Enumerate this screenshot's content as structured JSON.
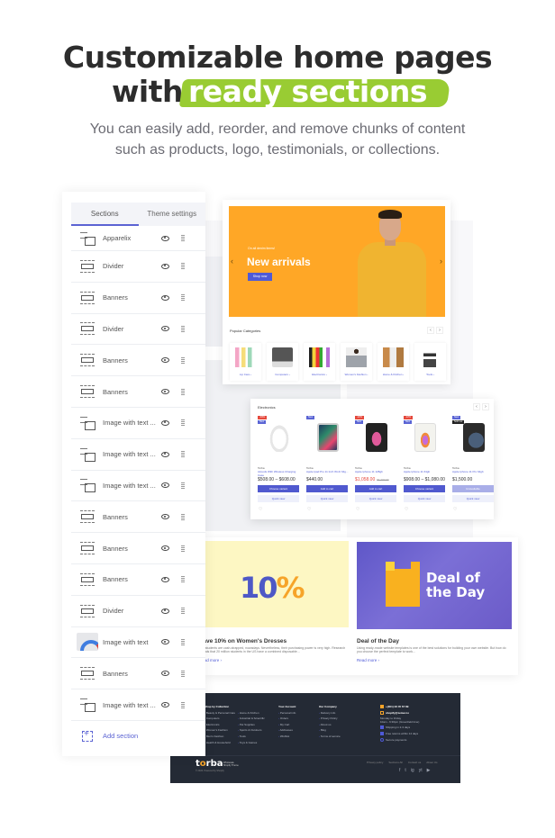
{
  "header": {
    "title_line1": "Customizable home pages",
    "title_line2_prefix": "with",
    "title_line2_highlight": "ready sections",
    "subtitle_line1": "You can easily add, reorder, and remove chunks of content",
    "subtitle_line2": "such as products, logo, testimonials, or collections.",
    "highlight_color": "#99cc33"
  },
  "sidebar": {
    "tabs": [
      {
        "label": "Sections",
        "active": true
      },
      {
        "label": "Theme settings",
        "active": false
      }
    ],
    "items": [
      {
        "label": "Apparelix",
        "icon": "image-with-text-icon"
      },
      {
        "label": "Divider",
        "icon": "banner-icon"
      },
      {
        "label": "Banners",
        "icon": "banner-icon"
      },
      {
        "label": "Divider",
        "icon": "banner-icon"
      },
      {
        "label": "Banners",
        "icon": "banner-icon"
      },
      {
        "label": "Banners",
        "icon": "banner-icon"
      },
      {
        "label": "Image with text ...",
        "icon": "image-with-text-icon"
      },
      {
        "label": "Image with text ...",
        "icon": "image-with-text-icon"
      },
      {
        "label": "Image with text ...",
        "icon": "image-with-text-icon"
      },
      {
        "label": "Banners",
        "icon": "banner-icon"
      },
      {
        "label": "Banners",
        "icon": "banner-icon"
      },
      {
        "label": "Banners",
        "icon": "banner-icon"
      },
      {
        "label": "Divider",
        "icon": "banner-icon"
      },
      {
        "label": "Image with text",
        "icon": "gauge-thumbnail-icon"
      },
      {
        "label": "Banners",
        "icon": "banner-icon"
      },
      {
        "label": "Image with text ...",
        "icon": "image-with-text-icon"
      }
    ],
    "add_section_label": "Add section",
    "accent_color": "#5b63d3"
  },
  "hero_banner": {
    "kicker": "On all denim items!",
    "title": "New arrivals",
    "button_label": "Shop now",
    "prev_arrow": "‹",
    "next_arrow": "›",
    "background_color": "#ffa726"
  },
  "categories": {
    "title": "Popular Categories",
    "items": [
      {
        "label": "Lip Care ›"
      },
      {
        "label": "Computers ›"
      },
      {
        "label": "Electronics ›"
      },
      {
        "label": "Women's Fashion ›"
      },
      {
        "label": "Home & Kitchen ›"
      },
      {
        "label": "Tools ›"
      }
    ]
  },
  "electronics": {
    "title": "Electronics",
    "products": [
      {
        "vendor": "Torba",
        "name": "Airpods With Wireless Charging Case",
        "price": "$508.00 – $608.00",
        "old_price": "",
        "on_sale": false,
        "badges": [
          "-33%",
          "New"
        ],
        "button": "Choose variant",
        "unavailable": false,
        "quick_view": "Quick view"
      },
      {
        "vendor": "Torba",
        "name": "Apple Ipad Pro 11 Inch Wi-Fi 64g...",
        "price": "$440.00",
        "old_price": "",
        "on_sale": false,
        "badges": [
          "New"
        ],
        "button": "Add to cart",
        "unavailable": false,
        "quick_view": "Quick view"
      },
      {
        "vendor": "Torba",
        "name": "Apple Iphone 11 128gb",
        "price": "$1,058.00",
        "old_price": "$1,200.00",
        "on_sale": true,
        "badges": [
          "-12%",
          "New"
        ],
        "button": "Add to cart",
        "unavailable": false,
        "quick_view": "Quick view"
      },
      {
        "vendor": "Torba",
        "name": "Apple Iphone 11 64gb",
        "price": "$908.00 – $1,080.00",
        "old_price": "",
        "on_sale": false,
        "badges": [
          "-12%",
          "New"
        ],
        "button": "Choose variant",
        "unavailable": false,
        "quick_view": "Quick view"
      },
      {
        "vendor": "Torba",
        "name": "Apple Iphone 11 Pro 64gb",
        "price": "$1,500.00",
        "old_price": "",
        "on_sale": false,
        "badges": [
          "New",
          "Sold out"
        ],
        "button": "Unavailable",
        "unavailable": true,
        "quick_view": "Quick view"
      }
    ]
  },
  "blog": {
    "posts": [
      {
        "image_text": "10",
        "image_pct": "%",
        "title": "Save 10% on Women's Dresses",
        "excerpt": "Our students are cash-strapped, nowadays. Nevertheless, their purchasing power is very high. Research reveals that 20 million students in the US have a combined disposable...",
        "read_more": "Read more ›"
      },
      {
        "image_text_line1": "Deal of",
        "image_text_line2": "the Day",
        "title": "Deal of the Day",
        "excerpt": "Using ready-made website templates is one of the best solutions for building your own website. But how do you choose the perfect template to work...",
        "read_more": "Read more ›"
      }
    ]
  },
  "footer": {
    "columns": [
      {
        "heading": "Shop by Collection",
        "items": [
          "Beauty & Personal Care",
          "Computers",
          "Electronics",
          "Women's Fashion",
          "Men's Fashion",
          "Health & Household"
        ]
      },
      {
        "heading": "",
        "items": [
          "Home & Kitchen",
          "Industrial & Scientific",
          "Pet Supplies",
          "Sports & Outdoors",
          "Tools",
          "Toys & Games"
        ]
      },
      {
        "heading": "Your Account",
        "items": [
          "Personal info",
          "Orders",
          "My Cart",
          "Addresses",
          "Wishlist"
        ]
      },
      {
        "heading": "Our Company",
        "items": [
          "Delivery info",
          "Privacy Policy",
          "About us",
          "Blog",
          "Terms of service"
        ]
      }
    ],
    "contact": {
      "phone": "+(301) 23 45 67 89",
      "email": "shopify@zemez.io",
      "hours_line1": "Monday to Friday",
      "hours_line2": "10am - 6:30pm (Greenfield time)",
      "features": [
        "Shipping in 2-3 days",
        "Free returns within 14 days",
        "Secure payments"
      ]
    },
    "logo_text_pre": "t",
    "logo_text_mid": "o",
    "logo_text_post": "rba",
    "logo_tagline_line1": "Wholesale",
    "logo_tagline_line2": "Shopify Theme",
    "copyright": "© 2020. Powered by Shopify",
    "links": [
      "Privacy policy",
      "Sections All",
      "Contact us",
      "About Us"
    ],
    "social": [
      "f",
      "t",
      "ig",
      "yt",
      "▶"
    ]
  }
}
